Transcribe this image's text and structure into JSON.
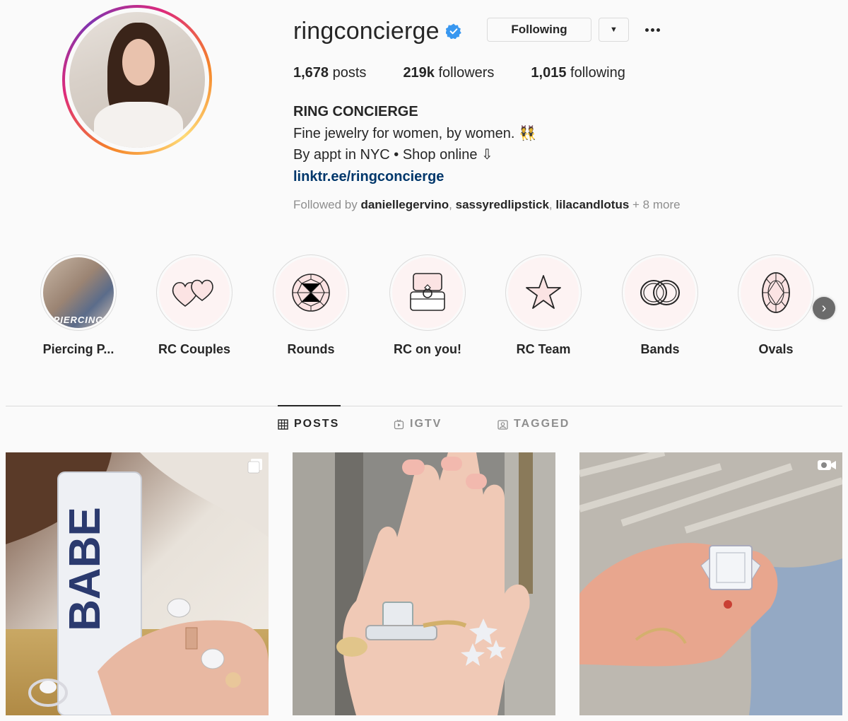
{
  "profile": {
    "username": "ringconcierge",
    "following_label": "Following",
    "stats": {
      "posts_count": "1,678",
      "posts_label": "posts",
      "followers_count": "219k",
      "followers_label": "followers",
      "following_count": "1,015",
      "following_label": "following"
    },
    "bio": {
      "name": "RING CONCIERGE",
      "line1": "Fine jewelry for women, by women. 👯",
      "line2": "By appt in NYC • Shop online ⇩",
      "link": "linktr.ee/ringconcierge"
    },
    "followed_by": {
      "prefix": "Followed by",
      "users": [
        "daniellegervino",
        "sassyredlipstick",
        "lilacandlotus"
      ],
      "suffix": "+ 8 more"
    }
  },
  "highlights": [
    {
      "label": "Piercing P...",
      "icon": "photo-thumbnail",
      "overlay_text": "PIERCING"
    },
    {
      "label": "RC Couples",
      "icon": "hearts-icon"
    },
    {
      "label": "Rounds",
      "icon": "round-diamond-icon"
    },
    {
      "label": "RC on you!",
      "icon": "ring-box-icon"
    },
    {
      "label": "RC Team",
      "icon": "star-icon"
    },
    {
      "label": "Bands",
      "icon": "bands-icon"
    },
    {
      "label": "Ovals",
      "icon": "oval-diamond-icon"
    }
  ],
  "tabs": [
    {
      "label": "POSTS",
      "icon": "grid-icon",
      "active": true
    },
    {
      "label": "IGTV",
      "icon": "igtv-icon",
      "active": false
    },
    {
      "label": "TAGGED",
      "icon": "tagged-icon",
      "active": false
    }
  ],
  "posts": [
    {
      "alt": "hand with rings holding BABE can",
      "badge": "carousel-icon",
      "can_text": "BABE"
    },
    {
      "alt": "hand with stacked diamond rings",
      "badge": ""
    },
    {
      "alt": "hand holding emerald cut diamond ring",
      "badge": "video-icon"
    }
  ],
  "colors": {
    "background": "#fafafa",
    "text": "#262626",
    "muted": "#8e8e8e",
    "link": "#00376b",
    "verified": "#3897f0",
    "border": "#dbdbdb",
    "highlight_bg": "#fdf3f3"
  }
}
